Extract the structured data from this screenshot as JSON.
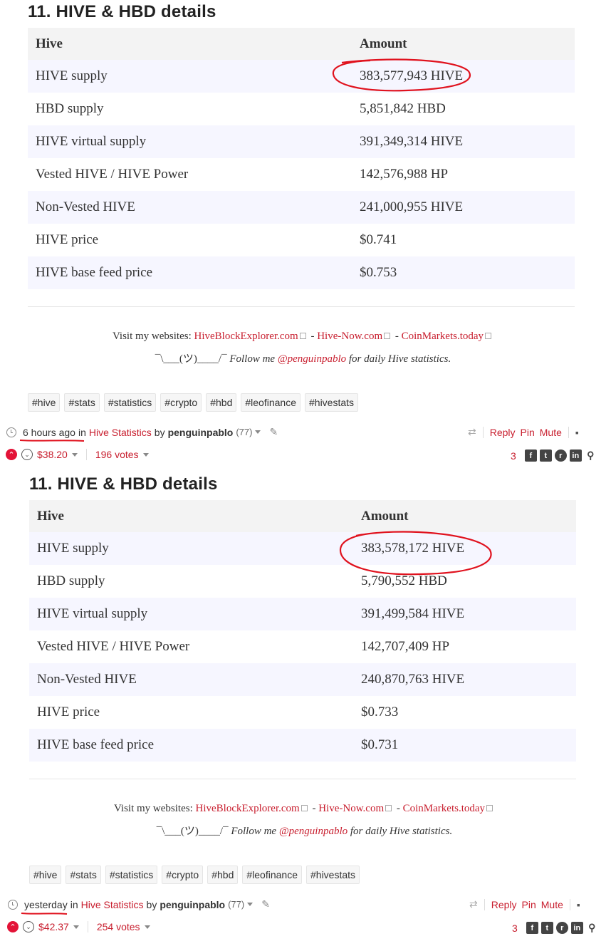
{
  "posts": [
    {
      "heading": "11. HIVE & HBD details",
      "table": {
        "headers": [
          "Hive",
          "Amount"
        ],
        "rows": [
          [
            "HIVE supply",
            "383,577,943 HIVE"
          ],
          [
            "HBD supply",
            "5,851,842 HBD"
          ],
          [
            "HIVE virtual supply",
            "391,349,314 HIVE"
          ],
          [
            "Vested HIVE / HIVE Power",
            "142,576,988 HP"
          ],
          [
            "Non-Vested HIVE",
            "241,000,955 HIVE"
          ],
          [
            "HIVE price",
            "$0.741"
          ],
          [
            "HIVE base feed price",
            "$0.753"
          ]
        ]
      },
      "footer": {
        "visit_prefix": "Visit my websites: ",
        "site1": "HiveBlockExplorer.com",
        "site2": "Hive-Now.com",
        "site3": "CoinMarkets.today",
        "dash": " - ",
        "shrug": "¯\\___(ツ)____/¯",
        "follow_prefix": " Follow me ",
        "handle": "@penguinpablo",
        "follow_suffix": " for daily Hive statistics."
      },
      "tags": [
        "#hive",
        "#stats",
        "#statistics",
        "#crypto",
        "#hbd",
        "#leofinance",
        "#hivestats"
      ],
      "meta": {
        "time": "6 hours ago",
        "in": "in",
        "community": "Hive Statistics",
        "by": "by",
        "author": "penguinpablo",
        "rep": "(77)"
      },
      "actions": {
        "reply": "Reply",
        "pin": "Pin",
        "mute": "Mute"
      },
      "payout": "$38.20",
      "votes": "196 votes",
      "comment_count": "3"
    },
    {
      "heading": "11. HIVE & HBD details",
      "table": {
        "headers": [
          "Hive",
          "Amount"
        ],
        "rows": [
          [
            "HIVE supply",
            "383,578,172 HIVE"
          ],
          [
            "HBD supply",
            "5,790,552 HBD"
          ],
          [
            "HIVE virtual supply",
            "391,499,584 HIVE"
          ],
          [
            "Vested HIVE / HIVE Power",
            "142,707,409 HP"
          ],
          [
            "Non-Vested HIVE",
            "240,870,763 HIVE"
          ],
          [
            "HIVE price",
            "$0.733"
          ],
          [
            "HIVE base feed price",
            "$0.731"
          ]
        ]
      },
      "footer": {
        "visit_prefix": "Visit my websites: ",
        "site1": "HiveBlockExplorer.com",
        "site2": "Hive-Now.com",
        "site3": "CoinMarkets.today",
        "dash": " - ",
        "shrug": "¯\\___(ツ)____/¯",
        "follow_prefix": " Follow me ",
        "handle": "@penguinpablo",
        "follow_suffix": " for daily Hive statistics."
      },
      "tags": [
        "#hive",
        "#stats",
        "#statistics",
        "#crypto",
        "#hbd",
        "#leofinance",
        "#hivestats"
      ],
      "meta": {
        "time": "yesterday",
        "in": "in",
        "community": "Hive Statistics",
        "by": "by",
        "author": "penguinpablo",
        "rep": "(77)"
      },
      "actions": {
        "reply": "Reply",
        "pin": "Pin",
        "mute": "Mute"
      },
      "payout": "$42.37",
      "votes": "254 votes",
      "comment_count": "3"
    }
  ],
  "icons": {
    "clock": "clock-icon",
    "edit": "pencil-icon",
    "reblog": "reblog-icon",
    "comments": "comments-icon",
    "upvote": "upvote-icon",
    "downvote": "downvote-icon",
    "facebook": "facebook-icon",
    "twitter": "twitter-icon",
    "reddit": "reddit-icon",
    "linkedin": "linkedin-icon",
    "permalink": "link-icon"
  },
  "colors": {
    "accent": "#c81e2e",
    "upvote": "#e31337",
    "annotation": "#e0121e"
  }
}
